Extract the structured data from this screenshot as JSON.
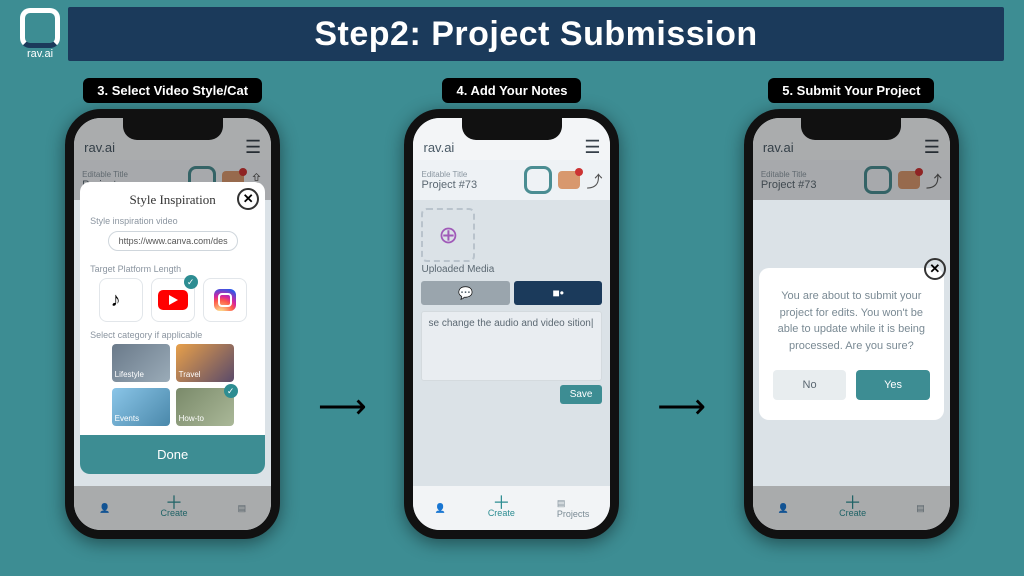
{
  "brand": "rav.ai",
  "title": "Step2: Project Submission",
  "steps": [
    {
      "label": "3. Select Video Style/Cat"
    },
    {
      "label": "4. Add Your Notes"
    },
    {
      "label": "5. Submit Your Project"
    }
  ],
  "phone1": {
    "modal_title": "Style Inspiration",
    "url_label": "Style inspiration video",
    "url_value": "https://www.canva.com/des",
    "platform_label": "Target Platform Length",
    "category_label": "Select category if applicable",
    "cats": [
      "Lifestyle",
      "Travel",
      "Events",
      "How-to"
    ],
    "done": "Done"
  },
  "phone2": {
    "title_label": "Editable Title",
    "project": "Project #73",
    "uploaded": "Uploaded Media",
    "notes": "se change the audio and video sition|",
    "save": "Save",
    "nav_create": "Create",
    "nav_projects": "Projects"
  },
  "phone3": {
    "title_label": "Editable Title",
    "project": "Project #73",
    "confirm_text": "You are about to submit your project for edits. You won't be able to update while it is being processed. Are you sure?",
    "no": "No",
    "yes": "Yes"
  }
}
